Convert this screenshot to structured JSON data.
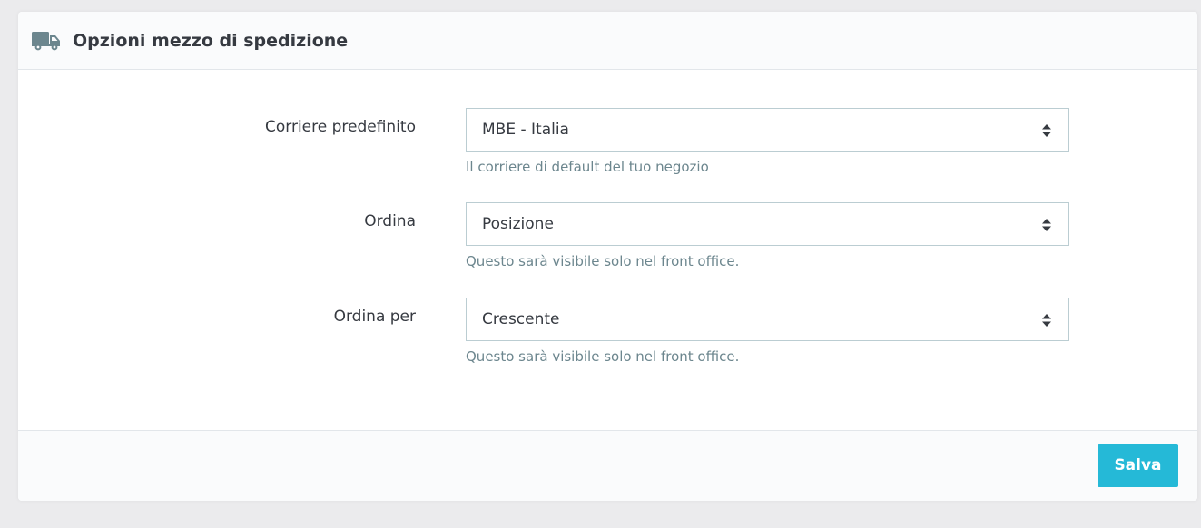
{
  "colors": {
    "page_background": "#ebebed",
    "header_background": "#fafbfc",
    "border": "#bbcdd2",
    "help_text": "#6c868e",
    "primary_button": "#25b9d7",
    "icon": "#6c868e"
  },
  "panel": {
    "icon": "truck-icon",
    "title": "Opzioni mezzo di spedizione"
  },
  "fields": [
    {
      "label": "Corriere predefinito",
      "value": "MBE - Italia",
      "help": "Il corriere di default del tuo negozio"
    },
    {
      "label": "Ordina",
      "value": "Posizione",
      "help": "Questo sarà visibile solo nel front office."
    },
    {
      "label": "Ordina per",
      "value": "Crescente",
      "help": "Questo sarà visibile solo nel front office."
    }
  ],
  "footer": {
    "save_label": "Salva"
  }
}
